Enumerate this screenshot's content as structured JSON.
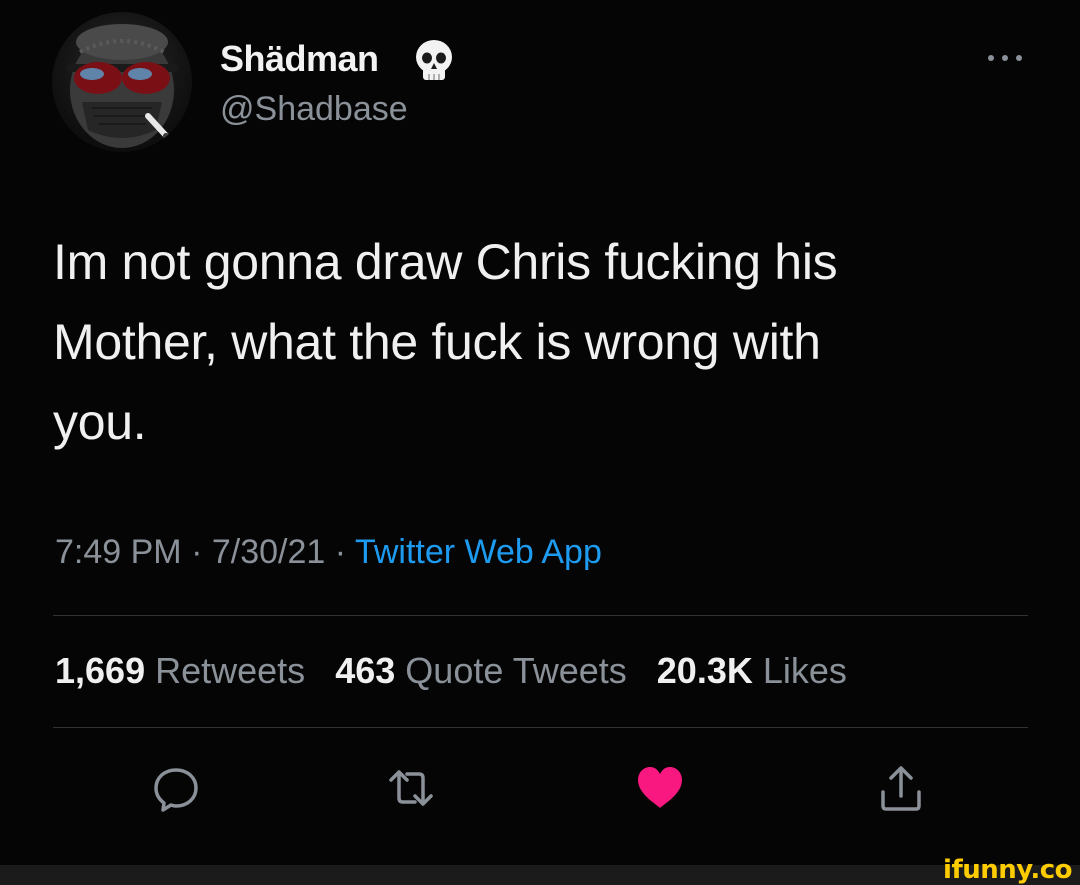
{
  "user": {
    "display_name": "Shädman",
    "handle": "@Shadbase",
    "badge_icon": "skull-icon"
  },
  "tweet": {
    "text_lines": [
      "Im not gonna draw Chris fucking his",
      "Mother, what the fuck is wrong with",
      "you."
    ],
    "time": "7:49 PM",
    "date": "7/30/21",
    "separator": "·",
    "source": "Twitter Web App"
  },
  "stats": {
    "retweets_count": "1,669",
    "retweets_label": "Retweets",
    "quotes_count": "463",
    "quotes_label": "Quote Tweets",
    "likes_count": "20.3K",
    "likes_label": "Likes"
  },
  "actions": [
    {
      "name": "reply",
      "icon": "reply-icon"
    },
    {
      "name": "retweet",
      "icon": "retweet-icon"
    },
    {
      "name": "like",
      "icon": "heart-icon",
      "liked": true
    },
    {
      "name": "share",
      "icon": "share-icon"
    }
  ],
  "colors": {
    "background": "#000000",
    "link": "#1d9bf0",
    "like_active": "#f91880",
    "muted_text": "#8b9199",
    "watermark": "#ffcc00"
  },
  "watermark": {
    "text": "ifunny.co"
  }
}
